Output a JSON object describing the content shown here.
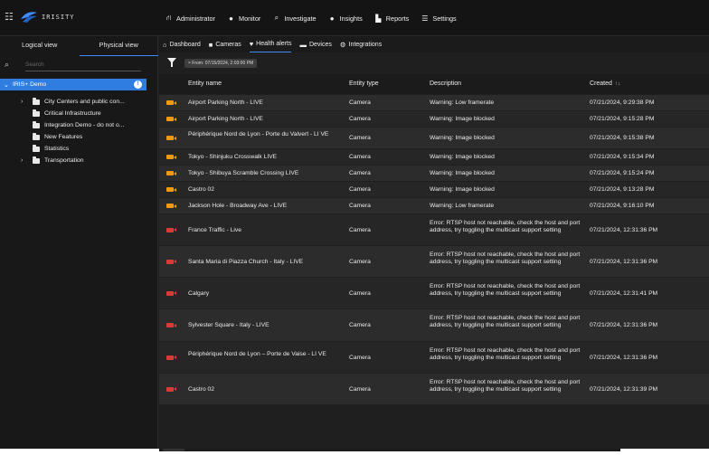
{
  "app": {
    "brand": "IRISITY",
    "nav": [
      {
        "label": "Administrator",
        "icon": "sitemap-icon"
      },
      {
        "label": "Monitor",
        "icon": "record-icon"
      },
      {
        "label": "Investigate",
        "icon": "search-icon"
      },
      {
        "label": "Insights",
        "icon": "bulb-icon"
      },
      {
        "label": "Reports",
        "icon": "chart-icon"
      },
      {
        "label": "Settings",
        "icon": "sliders-icon"
      }
    ]
  },
  "sidebar": {
    "tabs": [
      "Logical view",
      "Physical view"
    ],
    "active_tab": 1,
    "search_placeholder": "Search",
    "root": {
      "label": "IRIS+ Demo",
      "badge": "!"
    },
    "items": [
      {
        "label": "City Centers and public con...",
        "expandable": true
      },
      {
        "label": "Critical Infrastructure",
        "expandable": false
      },
      {
        "label": "Integration Demo - do not o...",
        "expandable": false
      },
      {
        "label": "New Features",
        "expandable": false
      },
      {
        "label": "Statistics",
        "expandable": false
      },
      {
        "label": "Transportation",
        "expandable": true
      }
    ]
  },
  "subnav": [
    {
      "label": "Dashboard",
      "icon": "home-icon"
    },
    {
      "label": "Cameras",
      "icon": "camera-icon"
    },
    {
      "label": "Health alerts",
      "icon": "heart-icon",
      "active": true
    },
    {
      "label": "Devices",
      "icon": "server-icon"
    },
    {
      "label": "Integrations",
      "icon": "gears-icon"
    }
  ],
  "filter": {
    "chip": "× From: 07/15/2024, 2:03:00 PM"
  },
  "table": {
    "columns": [
      "Entity name",
      "Entity type",
      "Description",
      "Created"
    ],
    "rows": [
      {
        "name": "Airport Parking North - LIVE",
        "type": "Camera",
        "description": "Warning: Low framerate",
        "created": "07/21/2024, 9:29:38 PM",
        "severity": "warning"
      },
      {
        "name": "Airport Parking North - LIVE",
        "type": "Camera",
        "description": "Warning: Image blocked",
        "created": "07/21/2024, 9:15:28 PM",
        "severity": "warning"
      },
      {
        "name": "Périphérique Nord de Lyon - Porte du Valvert - LI VE",
        "type": "Camera",
        "description": "Warning: Image blocked",
        "created": "07/21/2024, 9:15:38 PM",
        "severity": "warning"
      },
      {
        "name": "Tokyo - Shinjuku Crosswalk LIVE",
        "type": "Camera",
        "description": "Warning: Image blocked",
        "created": "07/21/2024, 9:15:34 PM",
        "severity": "warning"
      },
      {
        "name": "Tokyo - Shibuya Scramble Crossing LIVE",
        "type": "Camera",
        "description": "Warning: Image blocked",
        "created": "07/21/2024, 9:15:24 PM",
        "severity": "warning"
      },
      {
        "name": "Castro 02",
        "type": "Camera",
        "description": "Warning: Image blocked",
        "created": "07/21/2024, 9:13:28 PM",
        "severity": "warning"
      },
      {
        "name": "Jackson Hole - Broadway Ave - LIVE",
        "type": "Camera",
        "description": "Warning: Low framerate",
        "created": "07/21/2024, 9:16:10 PM",
        "severity": "warning"
      },
      {
        "name": "France Traffic - Live",
        "type": "Camera",
        "description": "Error: RTSP host not reachable, check the host and port address, try toggling the multicast support setting",
        "created": "07/21/2024, 12:31:36 PM",
        "severity": "error"
      },
      {
        "name": "Santa Maria di Piazza Church - Italy - LIVE",
        "type": "Camera",
        "description": "Error: RTSP host not reachable, check the host and port address, try toggling the multicast support setting",
        "created": "07/21/2024, 12:31:36 PM",
        "severity": "error"
      },
      {
        "name": "Calgary",
        "type": "Camera",
        "description": "Error: RTSP host not reachable, check the host and port address, try toggling the multicast support setting",
        "created": "07/21/2024, 12:31:41 PM",
        "severity": "error"
      },
      {
        "name": "Sylvester Square - Italy - LIVE",
        "type": "Camera",
        "description": "Error: RTSP host not reachable, check the host and port address, try toggling the multicast support setting",
        "created": "07/21/2024, 12:31:36 PM",
        "severity": "error"
      },
      {
        "name": "Périphérique Nord de Lyon – Porte de Vaise - LI VE",
        "type": "Camera",
        "description": "Error: RTSP host not reachable, check the host and port address, try toggling the multicast support setting",
        "created": "07/21/2024, 12:31:36 PM",
        "severity": "error"
      },
      {
        "name": "Castro 02",
        "type": "Camera",
        "description": "Error: RTSP host not reachable, check the host and port address, try toggling the multicast support setting",
        "created": "07/21/2024, 12:31:39 PM",
        "severity": "error"
      }
    ]
  }
}
